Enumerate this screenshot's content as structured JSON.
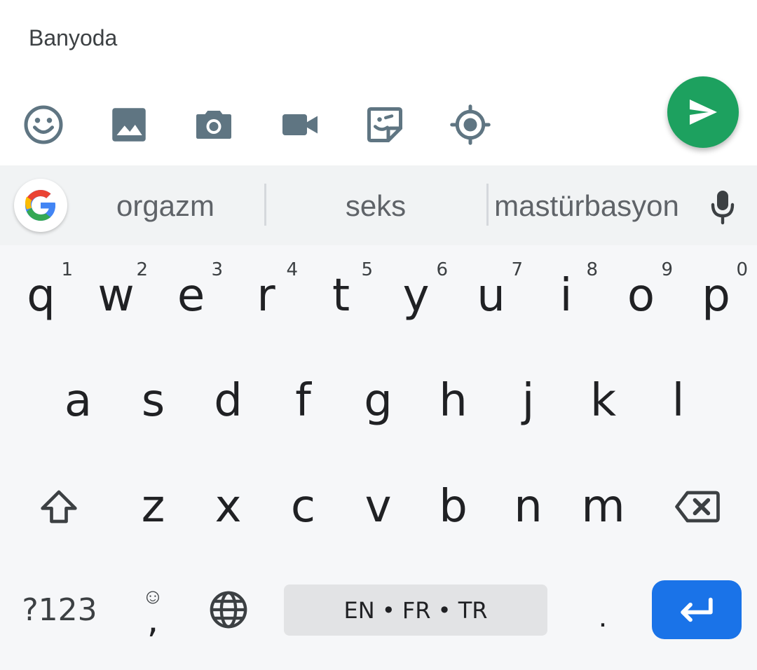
{
  "composer": {
    "message_text": "Banyoda",
    "attachments": [
      {
        "name": "emoji-icon"
      },
      {
        "name": "gallery-icon"
      },
      {
        "name": "camera-icon"
      },
      {
        "name": "video-icon"
      },
      {
        "name": "sticker-icon"
      },
      {
        "name": "location-icon"
      }
    ],
    "send_icon": "send-icon"
  },
  "keyboard": {
    "suggestions": [
      "orgazm",
      "seks",
      "mastürbasyon"
    ],
    "row1": [
      {
        "key": "q",
        "hint": "1"
      },
      {
        "key": "w",
        "hint": "2"
      },
      {
        "key": "e",
        "hint": "3"
      },
      {
        "key": "r",
        "hint": "4"
      },
      {
        "key": "t",
        "hint": "5"
      },
      {
        "key": "y",
        "hint": "6"
      },
      {
        "key": "u",
        "hint": "7"
      },
      {
        "key": "i",
        "hint": "8"
      },
      {
        "key": "o",
        "hint": "9"
      },
      {
        "key": "p",
        "hint": "0"
      }
    ],
    "row2": [
      "a",
      "s",
      "d",
      "f",
      "g",
      "h",
      "j",
      "k",
      "l"
    ],
    "row3": [
      "z",
      "x",
      "c",
      "v",
      "b",
      "n",
      "m"
    ],
    "symbols_label": "?123",
    "comma_label": ",",
    "comma_emoji_hint": "☺",
    "space_label": "EN • FR • TR",
    "period_label": ".",
    "colors": {
      "send_button": "#1da15f",
      "enter_key": "#1a73e8",
      "icon_gray": "#5f7582",
      "keyboard_bg": "#f6f7f9"
    }
  }
}
